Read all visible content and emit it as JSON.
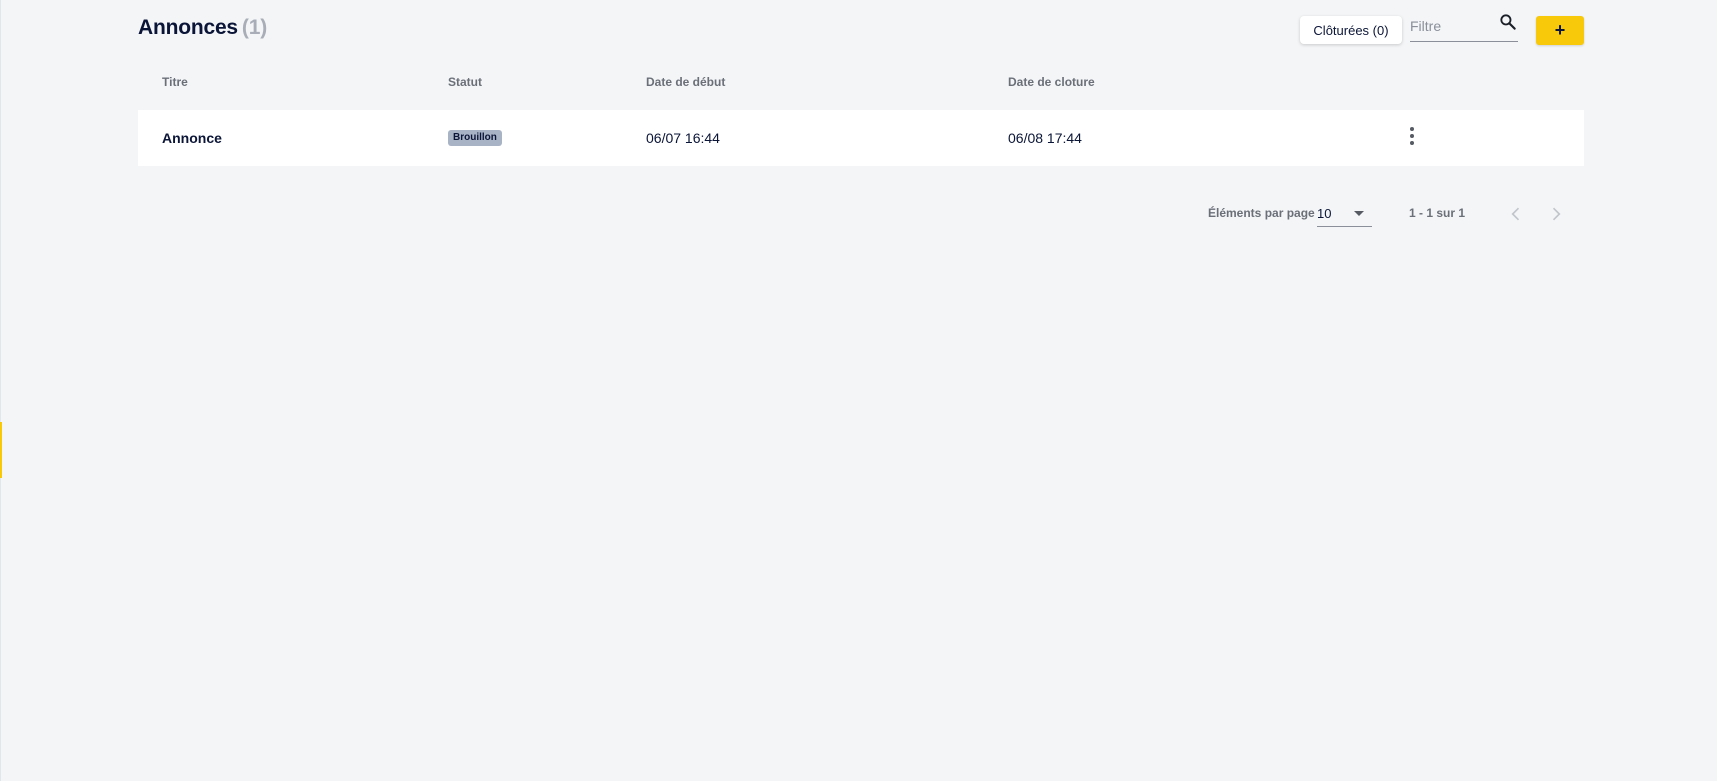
{
  "header": {
    "title": "Annonces",
    "count": "(1)",
    "closed_button": "Clôturées (0)",
    "filter_placeholder": "Filtre",
    "add_button": "+"
  },
  "table": {
    "columns": [
      "Titre",
      "Statut",
      "Date de début",
      "Date de cloture"
    ],
    "rows": [
      {
        "title": "Annonce",
        "status": "Brouillon",
        "start": "06/07 16:44",
        "end": "06/08 17:44"
      }
    ]
  },
  "pagination": {
    "label": "Éléments par page",
    "page_size": "10",
    "range": "1 - 1 sur 1"
  },
  "colors": {
    "accent": "#f8c90b",
    "background": "#f3f5f7",
    "text": "#0b1537",
    "badge": "#a9b3c6"
  },
  "icons": [
    "search-icon",
    "more-vertical-icon",
    "chevron-left-icon",
    "chevron-right-icon",
    "chevron-down-icon"
  ]
}
